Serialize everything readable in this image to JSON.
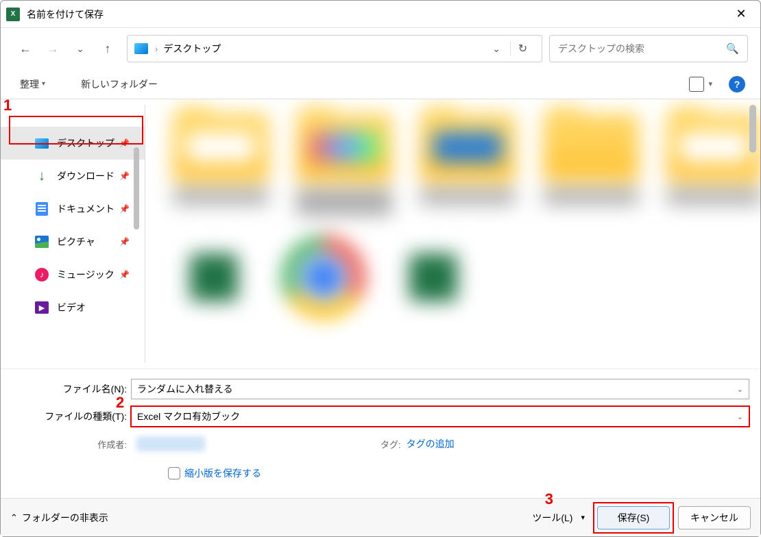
{
  "title": "名前を付けて保存",
  "address": {
    "path_sep": "›",
    "location": "デスクトップ"
  },
  "search": {
    "placeholder": "デスクトップの検索"
  },
  "toolbar": {
    "organize": "整理",
    "new_folder": "新しいフォルダー"
  },
  "sidebar": {
    "items": [
      {
        "label": "デスクトップ",
        "icon": "desktop",
        "selected": true
      },
      {
        "label": "ダウンロード",
        "icon": "download",
        "selected": false
      },
      {
        "label": "ドキュメント",
        "icon": "document",
        "selected": false
      },
      {
        "label": "ピクチャ",
        "icon": "picture",
        "selected": false
      },
      {
        "label": "ミュージック",
        "icon": "music",
        "selected": false
      },
      {
        "label": "ビデオ",
        "icon": "video",
        "selected": false
      }
    ]
  },
  "form": {
    "filename_label": "ファイル名(N):",
    "filename_value": "ランダムに入れ替える",
    "filetype_label": "ファイルの種類(T):",
    "filetype_value": "Excel マクロ有効ブック",
    "author_label": "作成者:",
    "tags_label": "タグ:",
    "tags_add": "タグの追加",
    "thumbnail_label": "縮小版を保存する"
  },
  "footer": {
    "hide_folders": "フォルダーの非表示",
    "tools": "ツール(L)",
    "save": "保存(S)",
    "cancel": "キャンセル"
  },
  "annotations": {
    "n1": "1",
    "n2": "2",
    "n3": "3"
  }
}
